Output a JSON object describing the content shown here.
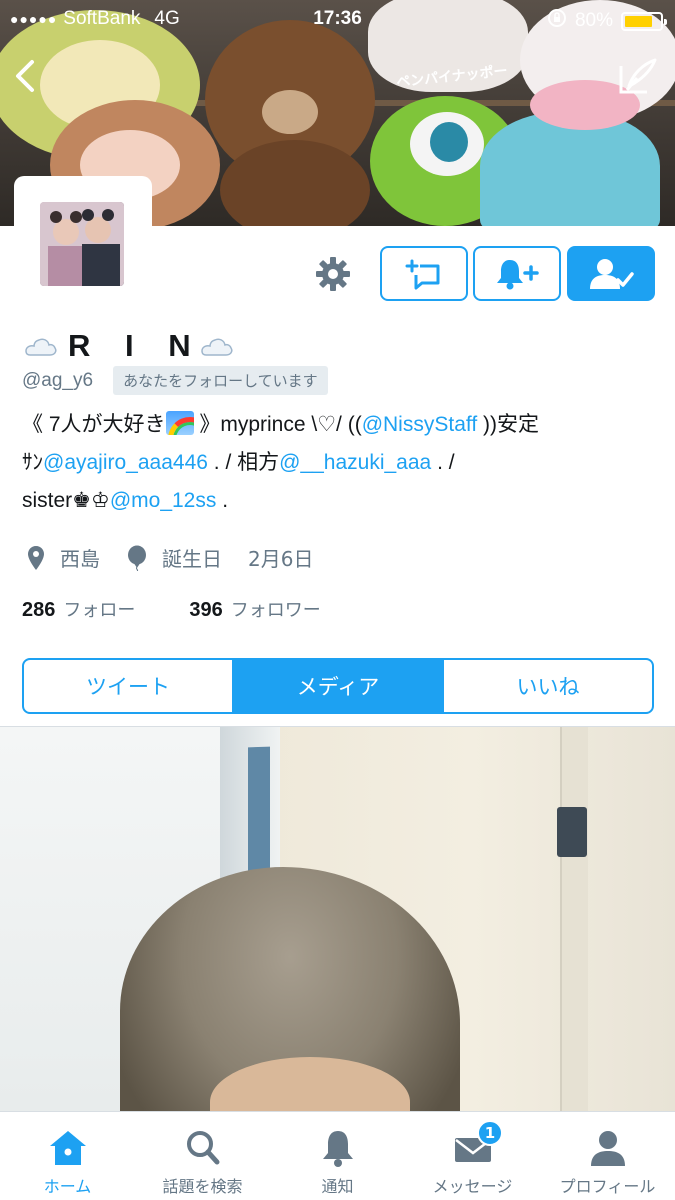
{
  "status_bar": {
    "signal_dots": "●●●●●",
    "carrier": "SoftBank",
    "network": "4G",
    "time": "17:36",
    "battery_percent": "80%",
    "battery_level": 0.8,
    "lock_icon": "orientation-lock-icon"
  },
  "header": {
    "back_icon": "chevron-left-icon",
    "compose_icon": "compose-tweet-icon",
    "banner_cushion_text": "ペンパイナッポー"
  },
  "profile": {
    "display_name": "R I N",
    "name_emoji": "☁️",
    "handle": "@ag_y6",
    "follows_you": "あなたをフォローしています",
    "bio": {
      "l1_a": "《 7人が大好き",
      "l1_b": " 》myprince \\♡/ ((",
      "l1_mention": "@NissyStaff",
      "l1_c": " ))安定",
      "l2_a": "ｻﾝ",
      "l2_mention1": "@ayajiro_aaa446",
      "l2_b": " . / 相方",
      "l2_mention2": "@__hazuki_aaa",
      "l2_c": " .  /",
      "l3_a": "sister♚♔",
      "l3_mention": "@mo_12ss",
      "l3_b": " ."
    },
    "location": "西島",
    "birthday_label": "誕生日",
    "birthday": "2月6日",
    "following_count": "286",
    "following_label": "フォロー",
    "followers_count": "396",
    "followers_label": "フォロワー"
  },
  "tabs": [
    {
      "label": "ツイート",
      "active": false
    },
    {
      "label": "メディア",
      "active": true
    },
    {
      "label": "いいね",
      "active": false
    }
  ],
  "tabbar": [
    {
      "label": "ホーム",
      "icon": "home-icon",
      "active": true
    },
    {
      "label": "話題を検索",
      "icon": "search-icon",
      "active": false
    },
    {
      "label": "通知",
      "icon": "bell-icon",
      "active": false
    },
    {
      "label": "メッセージ",
      "icon": "envelope-icon",
      "active": false,
      "badge": "1"
    },
    {
      "label": "プロフィール",
      "icon": "person-icon",
      "active": false
    }
  ],
  "colors": {
    "accent": "#1da1f2",
    "secondary_text": "#657786",
    "battery": "#ffd000"
  }
}
